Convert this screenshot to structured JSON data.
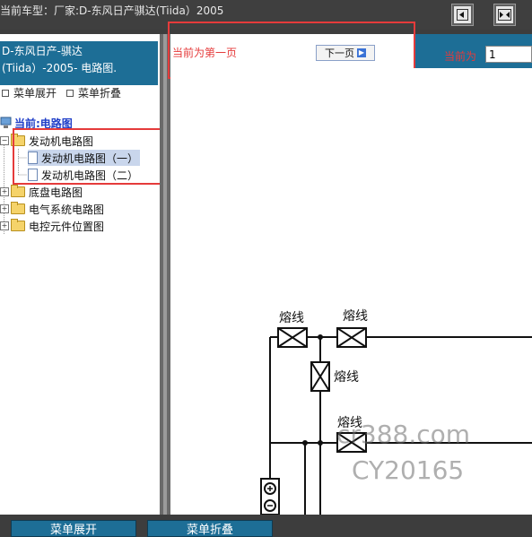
{
  "topbar": {
    "car_info": "当前车型：厂家:D-东风日产骐达(Tiida）2005"
  },
  "sidebar": {
    "model_header": "D-东风日产-骐达(Tiida）-2005- 电路图.",
    "expand_label": "菜单展开",
    "collapse_label": "菜单折叠",
    "current_label": "当前:电路图",
    "tree": {
      "engine": "发动机电路图",
      "engine_child_1": "发动机电路图（一）",
      "engine_child_2": "发动机电路图（二）",
      "chassis": "底盘电路图",
      "electrical": "电气系统电路图",
      "ecu_location": "电控元件位置图"
    }
  },
  "content": {
    "page_status": "当前为第一页",
    "next_label": "下一页",
    "current_label": "当前为",
    "page_value": "1"
  },
  "diagram": {
    "fuse_label": "熔线",
    "watermark_1": "cr388.com",
    "watermark_2": "CY20165"
  },
  "bottom": {
    "expand_label": "菜单展开",
    "collapse_label": "菜单折叠"
  }
}
